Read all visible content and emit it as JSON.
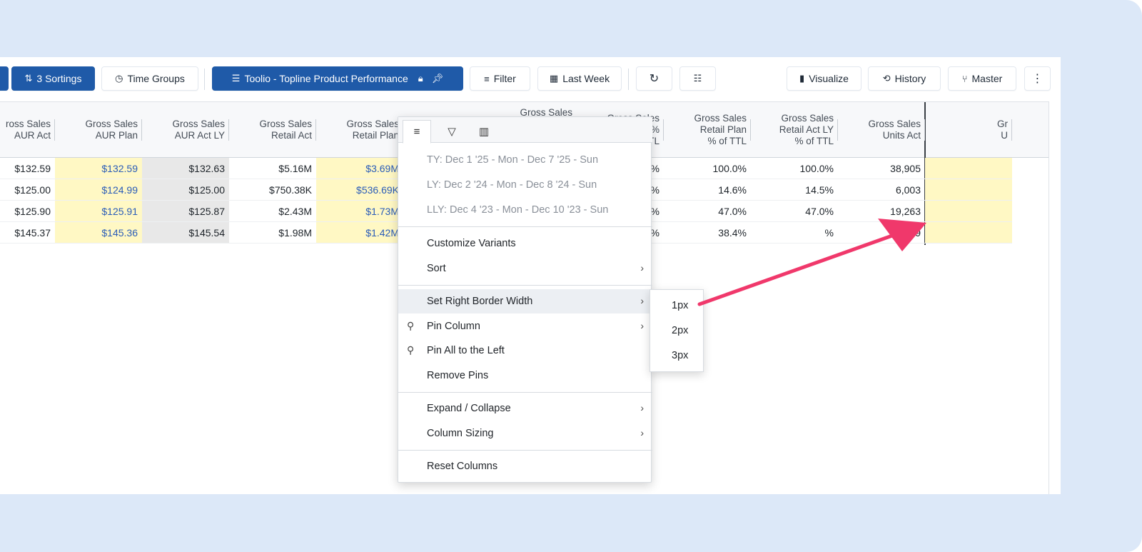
{
  "toolbar": {
    "sortings": "3 Sortings",
    "time_groups": "Time Groups",
    "view_name": "Toolio - Topline Product Performance",
    "filter": "Filter",
    "last_week": "Last Week",
    "visualize": "Visualize",
    "history": "History",
    "master": "Master"
  },
  "columns": [
    {
      "label": "ross Sales\nAUR Act",
      "type": "act"
    },
    {
      "label": "Gross Sales\nAUR Plan",
      "type": "plan"
    },
    {
      "label": "Gross Sales\nAUR Act LY",
      "type": "ly"
    },
    {
      "label": "Gross Sales\nRetail Act",
      "type": "act"
    },
    {
      "label": "Gross Sales\nRetail Plan",
      "type": "plan"
    },
    {
      "label": "Gross Sales",
      "type": "act"
    },
    {
      "label": "Gross Sales\nar\nct\nLY",
      "type": "grn"
    },
    {
      "label": "Gross Sales\nRetail Act %\nof TTL",
      "type": "act"
    },
    {
      "label": "Gross Sales\nRetail Plan\n% of TTL",
      "type": "act"
    },
    {
      "label": "Gross Sales\nRetail Act LY\n% of TTL",
      "type": "act"
    },
    {
      "label": "Gross Sales\nUnits Act",
      "type": "act"
    },
    {
      "label": "Gr\nU",
      "type": "plan"
    }
  ],
  "rows": [
    [
      "$132.59",
      "$132.59",
      "$132.63",
      "$5.16M",
      "$3.69M",
      "",
      "%",
      "100.0%",
      "100.0%",
      "100.0%",
      "38,905",
      ""
    ],
    [
      "$125.00",
      "$124.99",
      "$125.00",
      "$750.38K",
      "$536.69K",
      "",
      "%",
      "14.6%",
      "14.6%",
      "14.5%",
      "6,003",
      ""
    ],
    [
      "$125.90",
      "$125.91",
      "$125.87",
      "$2.43M",
      "$1.73M",
      "",
      "%",
      "47.0%",
      "47.0%",
      "47.0%",
      "19,263",
      ""
    ],
    [
      "$145.37",
      "$145.36",
      "$145.54",
      "$1.98M",
      "$1.42M",
      "",
      "%",
      "38.4%",
      "38.4%",
      "%",
      "13,639",
      ""
    ]
  ],
  "menu": {
    "tabs": [
      "menu-icon",
      "filter-icon",
      "columns-icon"
    ],
    "time_ty": "TY: Dec 1 '25 - Mon - Dec 7 '25 - Sun",
    "time_ly": "LY: Dec 2 '24 - Mon - Dec 8 '24 - Sun",
    "time_lly": "LLY: Dec 4 '23 - Mon - Dec 10 '23 - Sun",
    "customize_variants": "Customize Variants",
    "sort": "Sort",
    "set_right_border_width": "Set Right Border Width",
    "pin_column": "Pin Column",
    "pin_all_left": "Pin All to the Left",
    "remove_pins": "Remove Pins",
    "expand_collapse": "Expand / Collapse",
    "column_sizing": "Column Sizing",
    "reset_columns": "Reset Columns"
  },
  "submenu": {
    "options": [
      "1px",
      "2px",
      "3px"
    ]
  },
  "colors": {
    "primary": "#1f5aa8",
    "plan_bg": "#fff8c4",
    "ly_bg": "#e8e8e8",
    "arrow": "#f0386b"
  }
}
